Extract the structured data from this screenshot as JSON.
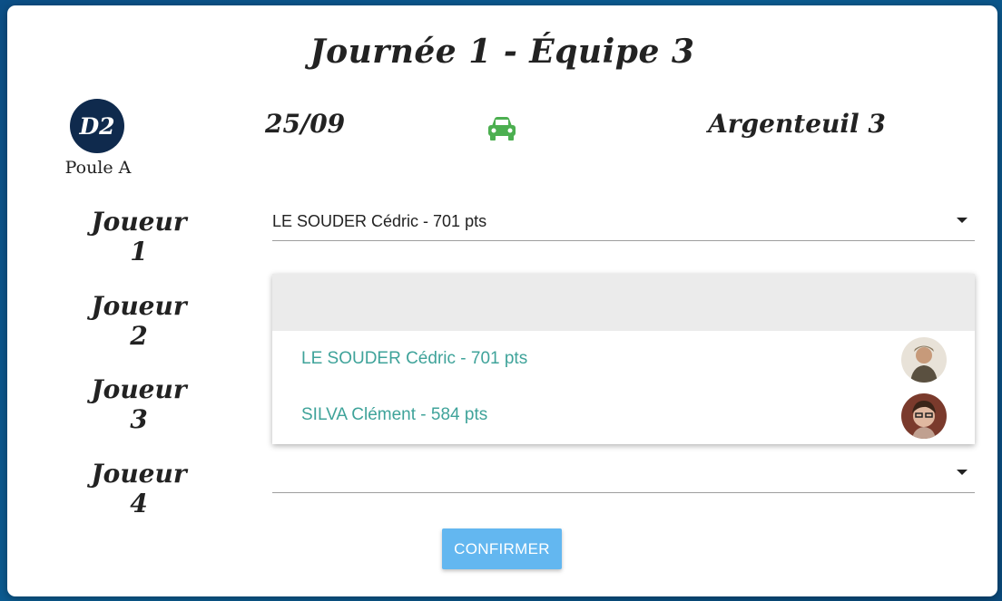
{
  "header": {
    "title": "Journée 1 - Équipe 3"
  },
  "match": {
    "division": "D2",
    "poule": "Poule A",
    "date": "25/09",
    "travel_icon": "car-icon",
    "opponent": "Argenteuil 3"
  },
  "players": {
    "joueur1": {
      "label": "Joueur 1",
      "value": "LE SOUDER Cédric - 701 pts"
    },
    "joueur2": {
      "label": "Joueur 2",
      "value": ""
    },
    "joueur3": {
      "label": "Joueur 3",
      "value": ""
    },
    "joueur4": {
      "label": "Joueur 4",
      "value": ""
    }
  },
  "dropdown": {
    "options": [
      {
        "label": "LE SOUDER Cédric - 701 pts",
        "avatar": "avatar-icon"
      },
      {
        "label": "SILVA Clément - 584 pts",
        "avatar": "avatar-icon"
      }
    ]
  },
  "actions": {
    "confirm_label": "CONFIRMER"
  },
  "colors": {
    "background": "#0c4f86",
    "division_badge": "#0f2a4d",
    "car_icon": "#4caf50",
    "option_text": "#3fa39a",
    "confirm_button": "#63b7f0"
  }
}
